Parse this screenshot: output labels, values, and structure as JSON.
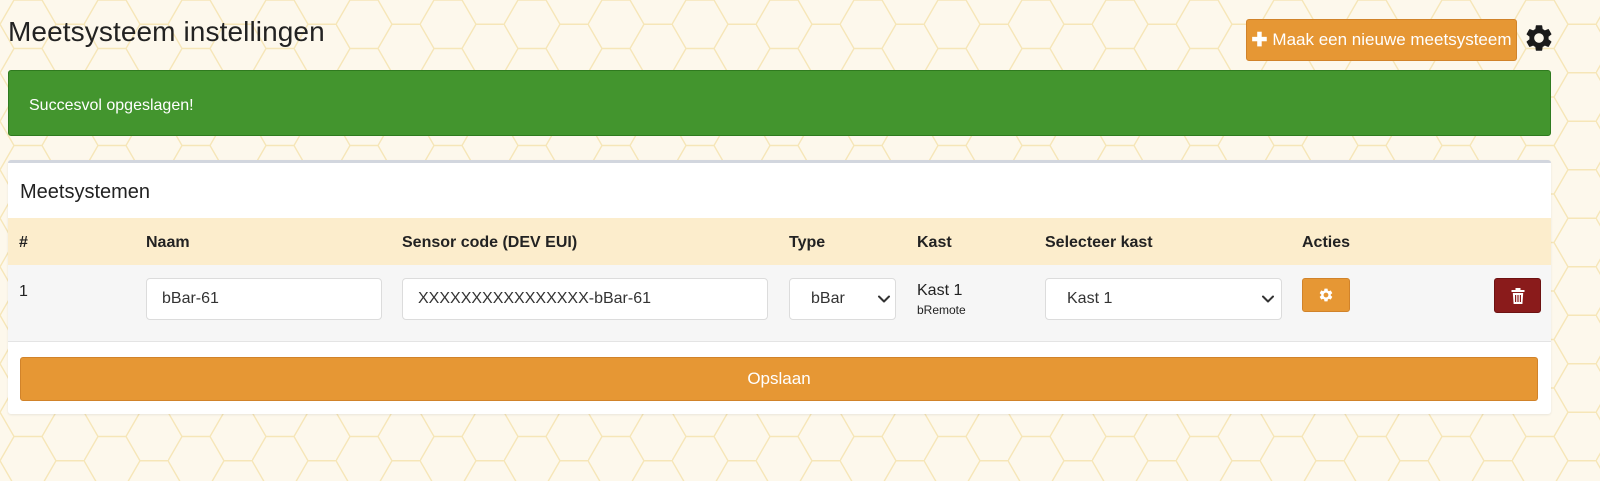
{
  "page": {
    "title": "Meetsysteem instellingen"
  },
  "header": {
    "new_button_label": "Maak een nieuwe meetsysteem",
    "plus_icon": "plus-icon",
    "settings_icon": "gear-icon"
  },
  "alert": {
    "message": "Succesvol opgeslagen!"
  },
  "panel": {
    "title": "Meetsystemen",
    "columns": [
      "#",
      "Naam",
      "Sensor code (DEV EUI)",
      "Type",
      "Kast",
      "Selecteer kast",
      "Acties"
    ],
    "rows": [
      {
        "number": "1",
        "name": "bBar-61",
        "sensor_code": "XXXXXXXXXXXXXXXX-bBar-61",
        "type": "bBar",
        "kast_name": "Kast 1",
        "kast_sub": "bRemote",
        "selected_kast": "Kast 1"
      }
    ],
    "save_label": "Opslaan"
  },
  "colors": {
    "accent": "#e69734",
    "success": "#43952e",
    "danger": "#8a1b1b",
    "table_header": "#fcedcc",
    "background": "#fdf8ec"
  }
}
